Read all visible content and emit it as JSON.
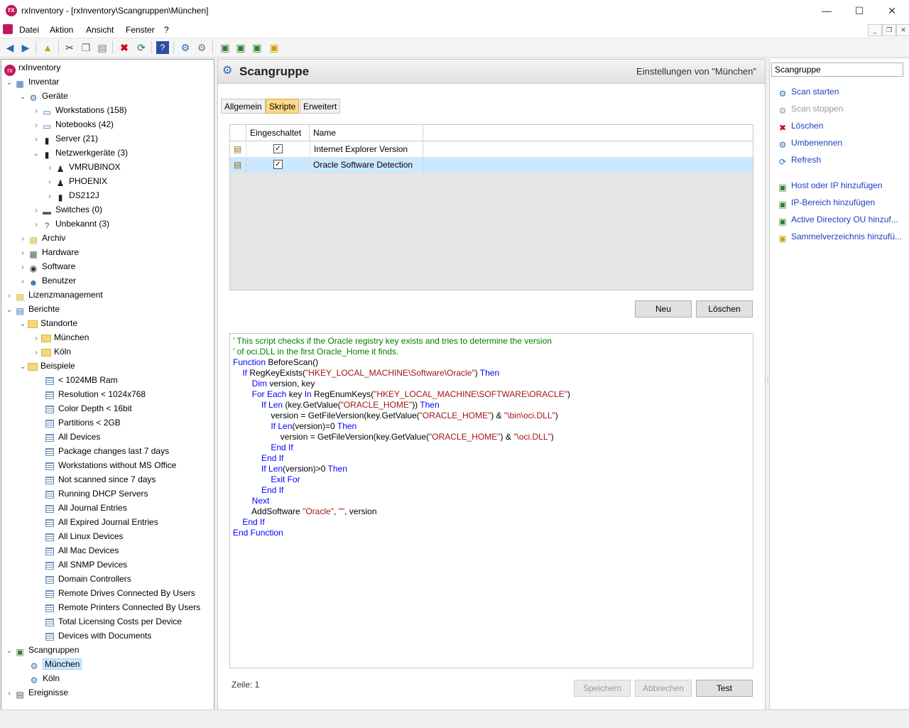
{
  "window": {
    "title": "rxInventory - [rxInventory\\Scangruppen\\München]",
    "app_icon_glyph": "rx",
    "minimize": "—",
    "maximize": "☐",
    "close": "✕"
  },
  "menu": {
    "items": [
      "Datei",
      "Aktion",
      "Ansicht",
      "Fenster",
      "?"
    ],
    "mdi_buttons": [
      "_",
      "❐",
      "✕"
    ]
  },
  "tree": {
    "root": "rxInventory",
    "inventar": "Inventar",
    "geraete": "Geräte",
    "workstations": "Workstations (158)",
    "notebooks": "Notebooks (42)",
    "server": "Server (21)",
    "netzwerkgeraete": "Netzwerkgeräte (3)",
    "vmrubinox": "VMRUBINOX",
    "phoenix": "PHOENIX",
    "ds212j": "DS212J",
    "switches": "Switches (0)",
    "unbekannt": "Unbekannt (3)",
    "archiv": "Archiv",
    "hardware": "Hardware",
    "software": "Software",
    "benutzer": "Benutzer",
    "lizenz": "Lizenzmanagement",
    "berichte": "Berichte",
    "standorte": "Standorte",
    "muenchen": "München",
    "koeln": "Köln",
    "beispiele": "Beispiele",
    "reports": [
      "< 1024MB Ram",
      "Resolution < 1024x768",
      "Color Depth < 16bit",
      "Partitions < 2GB",
      "All Devices",
      "Package changes last 7 days",
      "Workstations without MS Office",
      "Not scanned since 7 days",
      "Running DHCP Servers",
      "All Journal Entries",
      "All Expired Journal Entries",
      "All Linux Devices",
      "All Mac Devices",
      "All SNMP Devices",
      "Domain Controllers",
      "Remote Drives Connected By Users",
      "Remote Printers Connected By Users",
      "Total Licensing Costs per Device",
      "Devices with Documents"
    ],
    "scangruppen": "Scangruppen",
    "sg_muenchen": "München",
    "sg_koeln": "Köln",
    "ereignisse": "Ereignisse"
  },
  "panel": {
    "title": "Scangruppe",
    "subtitle": "Einstellungen von \"München\"",
    "tabs": [
      "Allgemein",
      "Skripte",
      "Erweitert"
    ],
    "active_tab": "Skripte",
    "columns": [
      "Eingeschaltet",
      "Name"
    ],
    "scripts": [
      {
        "enabled": true,
        "name": "Internet Explorer Version"
      },
      {
        "enabled": true,
        "name": "Oracle Software Detection"
      }
    ],
    "selected_script": "Oracle Software Detection",
    "btn_new": "Neu",
    "btn_delete": "Löschen",
    "code_lines": [
      [
        [
          "cm",
          "' This script checks if the Oracle registry key exists and tries to determine the version"
        ]
      ],
      [
        [
          "cm",
          "' of oci.DLL in the first Oracle_Home it finds."
        ]
      ],
      [
        [
          "kw",
          "Function"
        ],
        [
          "",
          " BeforeScan()"
        ]
      ],
      [
        [
          "",
          "    "
        ],
        [
          "kw",
          "If"
        ],
        [
          "",
          " RegKeyExists("
        ],
        [
          "st",
          "\"HKEY_LOCAL_MACHINE\\Software\\Oracle\""
        ],
        [
          "",
          ") "
        ],
        [
          "kw",
          "Then"
        ]
      ],
      [
        [
          "",
          "        "
        ],
        [
          "kw",
          "Dim"
        ],
        [
          "",
          " version, key"
        ]
      ],
      [
        [
          "",
          "        "
        ],
        [
          "kw",
          "For Each"
        ],
        [
          "",
          " key "
        ],
        [
          "kw",
          "In"
        ],
        [
          "",
          " RegEnumKeys("
        ],
        [
          "st",
          "\"HKEY_LOCAL_MACHINE\\SOFTWARE\\ORACLE\""
        ],
        [
          "",
          ")"
        ]
      ],
      [
        [
          "",
          "            "
        ],
        [
          "kw",
          "If Len"
        ],
        [
          "",
          " (key.GetValue("
        ],
        [
          "st",
          "\"ORACLE_HOME\""
        ],
        [
          "",
          ")) "
        ],
        [
          "kw",
          "Then"
        ]
      ],
      [
        [
          "",
          "                version = GetFileVersion(key.GetValue("
        ],
        [
          "st",
          "\"ORACLE_HOME\""
        ],
        [
          "",
          ") & "
        ],
        [
          "st",
          "\"\\bin\\oci.DLL\""
        ],
        [
          "",
          ")"
        ]
      ],
      [
        [
          "",
          "                "
        ],
        [
          "kw",
          "If Len"
        ],
        [
          "",
          "(version)=0 "
        ],
        [
          "kw",
          "Then"
        ]
      ],
      [
        [
          "",
          "                    version = GetFileVersion(key.GetValue("
        ],
        [
          "st",
          "\"ORACLE_HOME\""
        ],
        [
          "",
          ") & "
        ],
        [
          "st",
          "\"\\oci.DLL\""
        ],
        [
          "",
          ")"
        ]
      ],
      [
        [
          "",
          "                "
        ],
        [
          "kw",
          "End If"
        ]
      ],
      [
        [
          "",
          "            "
        ],
        [
          "kw",
          "End If"
        ]
      ],
      [
        [
          "",
          "            "
        ],
        [
          "kw",
          "If Len"
        ],
        [
          "",
          "(version)>0 "
        ],
        [
          "kw",
          "Then"
        ]
      ],
      [
        [
          "",
          "                "
        ],
        [
          "kw",
          "Exit For"
        ]
      ],
      [
        [
          "",
          "            "
        ],
        [
          "kw",
          "End If"
        ]
      ],
      [
        [
          "",
          "        "
        ],
        [
          "kw",
          "Next"
        ]
      ],
      [
        [
          "",
          "        AddSoftware "
        ],
        [
          "st",
          "\"Oracle\""
        ],
        [
          "",
          ", "
        ],
        [
          "st",
          "\"\""
        ],
        [
          "",
          ", version"
        ]
      ],
      [
        [
          "",
          "    "
        ],
        [
          "kw",
          "End If"
        ]
      ],
      [
        [
          "kw",
          "End Function"
        ]
      ]
    ],
    "line_info": "Zeile: 1",
    "btn_save": "Speichern",
    "btn_cancel": "Abbrechen",
    "btn_test": "Test"
  },
  "taskpane": {
    "combo": "Scangruppe",
    "actions": [
      {
        "label": "Scan starten",
        "icon": "scan-start-icon",
        "glyph": "⚙",
        "color": "#2b6cb0",
        "enabled": true
      },
      {
        "label": "Scan stoppen",
        "icon": "scan-stop-icon",
        "glyph": "⚙",
        "color": "#999999",
        "enabled": false
      },
      {
        "label": "Löschen",
        "icon": "delete-icon",
        "glyph": "✖",
        "color": "#d0021b",
        "enabled": true
      },
      {
        "label": "Umbenennen",
        "icon": "rename-icon",
        "glyph": "⚙",
        "color": "#2b6cb0",
        "enabled": true
      },
      {
        "label": "Refresh",
        "icon": "refresh-icon",
        "glyph": "⟳",
        "color": "#2b6cb0",
        "enabled": true
      }
    ],
    "add_actions": [
      {
        "label": "Host oder IP hinzufügen",
        "icon": "add-host-icon",
        "glyph": "▣",
        "color": "#2e7d32"
      },
      {
        "label": "IP-Bereich hinzufügen",
        "icon": "add-ip-range-icon",
        "glyph": "▣",
        "color": "#2e7d32"
      },
      {
        "label": "Active Directory OU hinzuf...",
        "icon": "add-ad-ou-icon",
        "glyph": "▣",
        "color": "#2e7d32"
      },
      {
        "label": "Sammelverzeichnis hinzufü...",
        "icon": "add-collection-folder-icon",
        "glyph": "▣",
        "color": "#c9a400"
      }
    ]
  }
}
